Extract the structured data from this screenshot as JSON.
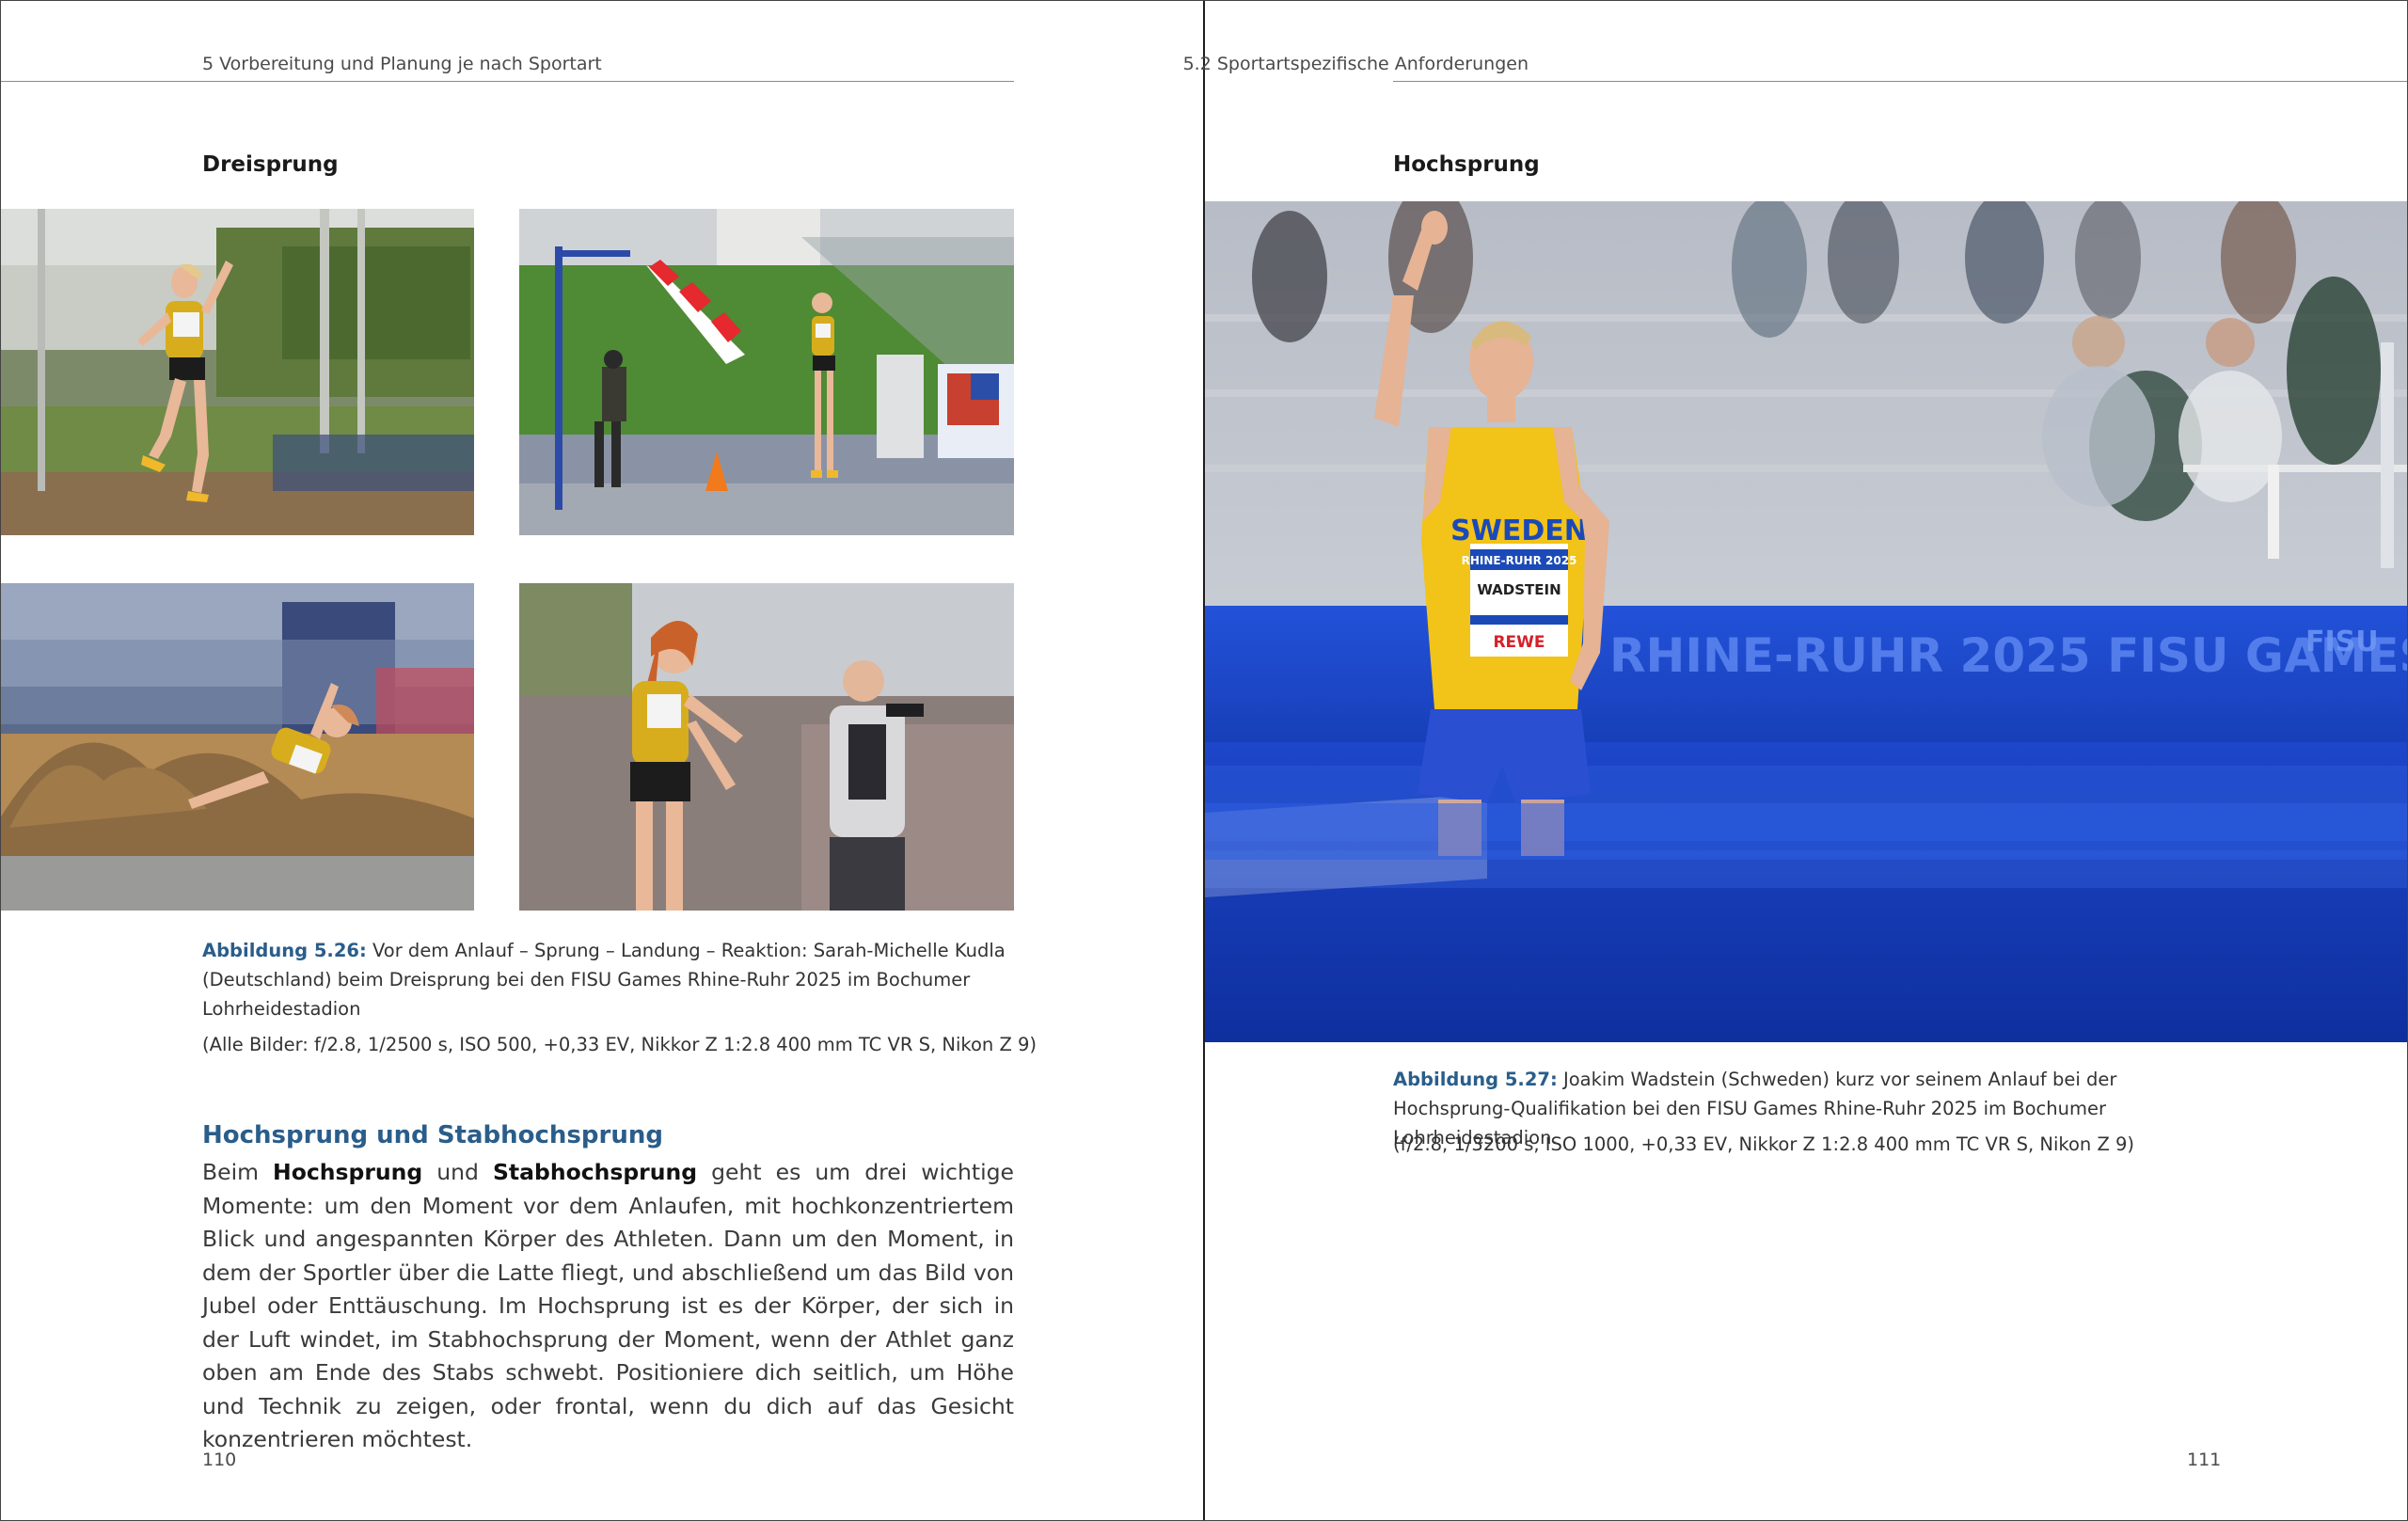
{
  "left": {
    "running_head": "5  Vorbereitung und Planung je nach Sportart",
    "section_heading": "Dreisprung",
    "caption": {
      "label": "Abbildung 5.26:",
      "text": " Vor dem Anlauf – Sprung – Landung – Reaktion: Sarah-Michelle Kudla (Deutschland) beim Dreisprung bei den FISU Games Rhine-Ruhr 2025 im Bochumer Lohrheidestadion",
      "exif": "(Alle Bilder: f/2.8, 1/2500 s, ISO 500, +0,33 EV, Nikkor Z 1:2.8 400 mm TC VR S, Nikon Z 9)"
    },
    "subheading": "Hochsprung und Stabhochsprung",
    "body": {
      "part1": "Beim ",
      "bold1": "Hochsprung",
      "part2": " und ",
      "bold2": "Stabhochsprung",
      "part3": " geht es um drei wichtige Momente: um den Moment vor dem Anlaufen, mit hochkonzentriertem Blick und angespannten Körper des Athleten. Dann um den Moment, in dem der Sportler über die Latte fliegt, und abschließend um das Bild von Jubel oder Enttäuschung. Im Hochsprung ist es der Kör­per, der sich in der Luft windet, im Stabhochsprung der Moment, wenn der Athlet ganz oben am Ende des Stabs schwebt. Positioniere dich seitlich, um Höhe und Technik zu zeigen, oder frontal, wenn du dich auf das Gesicht konzentrieren möchtest."
    },
    "page_number": "110"
  },
  "right": {
    "running_head": "5.2  Sportartspezifische Anforderungen",
    "section_heading": "Hochsprung",
    "photo_texts": {
      "bib_country": "SWEDEN",
      "bib_event": "RHINE-RUHR 2025",
      "bib_name": "WADSTEIN",
      "bib_sponsor": "REWE",
      "banner": "RHINE-RUHR 2025 FISU GAMES",
      "banner_logo": "FISU"
    },
    "caption": {
      "label": "Abbildung 5.27:",
      "text": " Joakim Wadstein (Schweden) kurz vor seinem Anlauf bei der Hochsprung-Qualifikation bei den FISU Games Rhine-Ruhr 2025 im Bochumer Lohrheidestadion.",
      "exif": "(f/2.8, 1/3200 s, ISO 1000, +0,33 EV, Nikkor Z 1:2.8 400 mm TC VR S, Nikon Z 9)"
    },
    "page_number": "111"
  },
  "colors": {
    "caption_label": "#2a5d8a",
    "subheading": "#2a5d8a",
    "jersey_yellow": "#f2c318",
    "banner_blue": "#1f4fd6"
  }
}
